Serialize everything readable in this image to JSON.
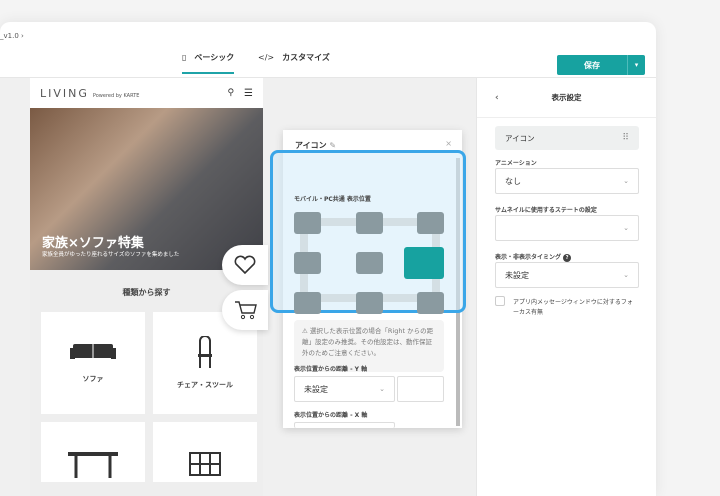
{
  "header": {
    "breadcrumb": "_v1.0 ›",
    "tabs": [
      {
        "label": "ベーシック",
        "icon": "layout-icon"
      },
      {
        "label": "カスタマイズ",
        "icon": "code-icon"
      }
    ],
    "save_label": "保存"
  },
  "preview": {
    "logo": "LIVING",
    "logo_sub": "Powered by KARTE",
    "hero_title": "家族×ソファ特集",
    "hero_sub": "家族全員がゆったり座れるサイズのソファを集めました",
    "section_title": "種類から探す",
    "categories": [
      "ソファ",
      "チェア・スツール",
      "",
      ""
    ]
  },
  "popup": {
    "title": "アイコン",
    "close": "×",
    "position_label": "モバイル・PC共通 表示位置",
    "selected_position": "middle-right",
    "warning": "⚠ 選択した表示位置の場合「Right からの距離」設定のみ推奨。その他設定は、動作保証外のためご注意ください。",
    "y_label": "表示位置からの距離 - Y 軸",
    "y_value": "未設定",
    "x_label": "表示位置からの距離 - X 軸"
  },
  "panel": {
    "back": "‹",
    "title": "表示設定",
    "chip": "アイコン",
    "animation_label": "アニメーション",
    "animation_value": "なし",
    "thumb_label": "サムネイルに使用するステートの設定",
    "thumb_value": "",
    "timing_label": "表示・非表示タイミング",
    "timing_help": "?",
    "timing_value": "未設定",
    "focus_label": "アプリ内メッセージウィンドウに対するフォーカス有無"
  },
  "colors": {
    "accent": "#17a2a0",
    "highlight": "#3aa6e8"
  }
}
